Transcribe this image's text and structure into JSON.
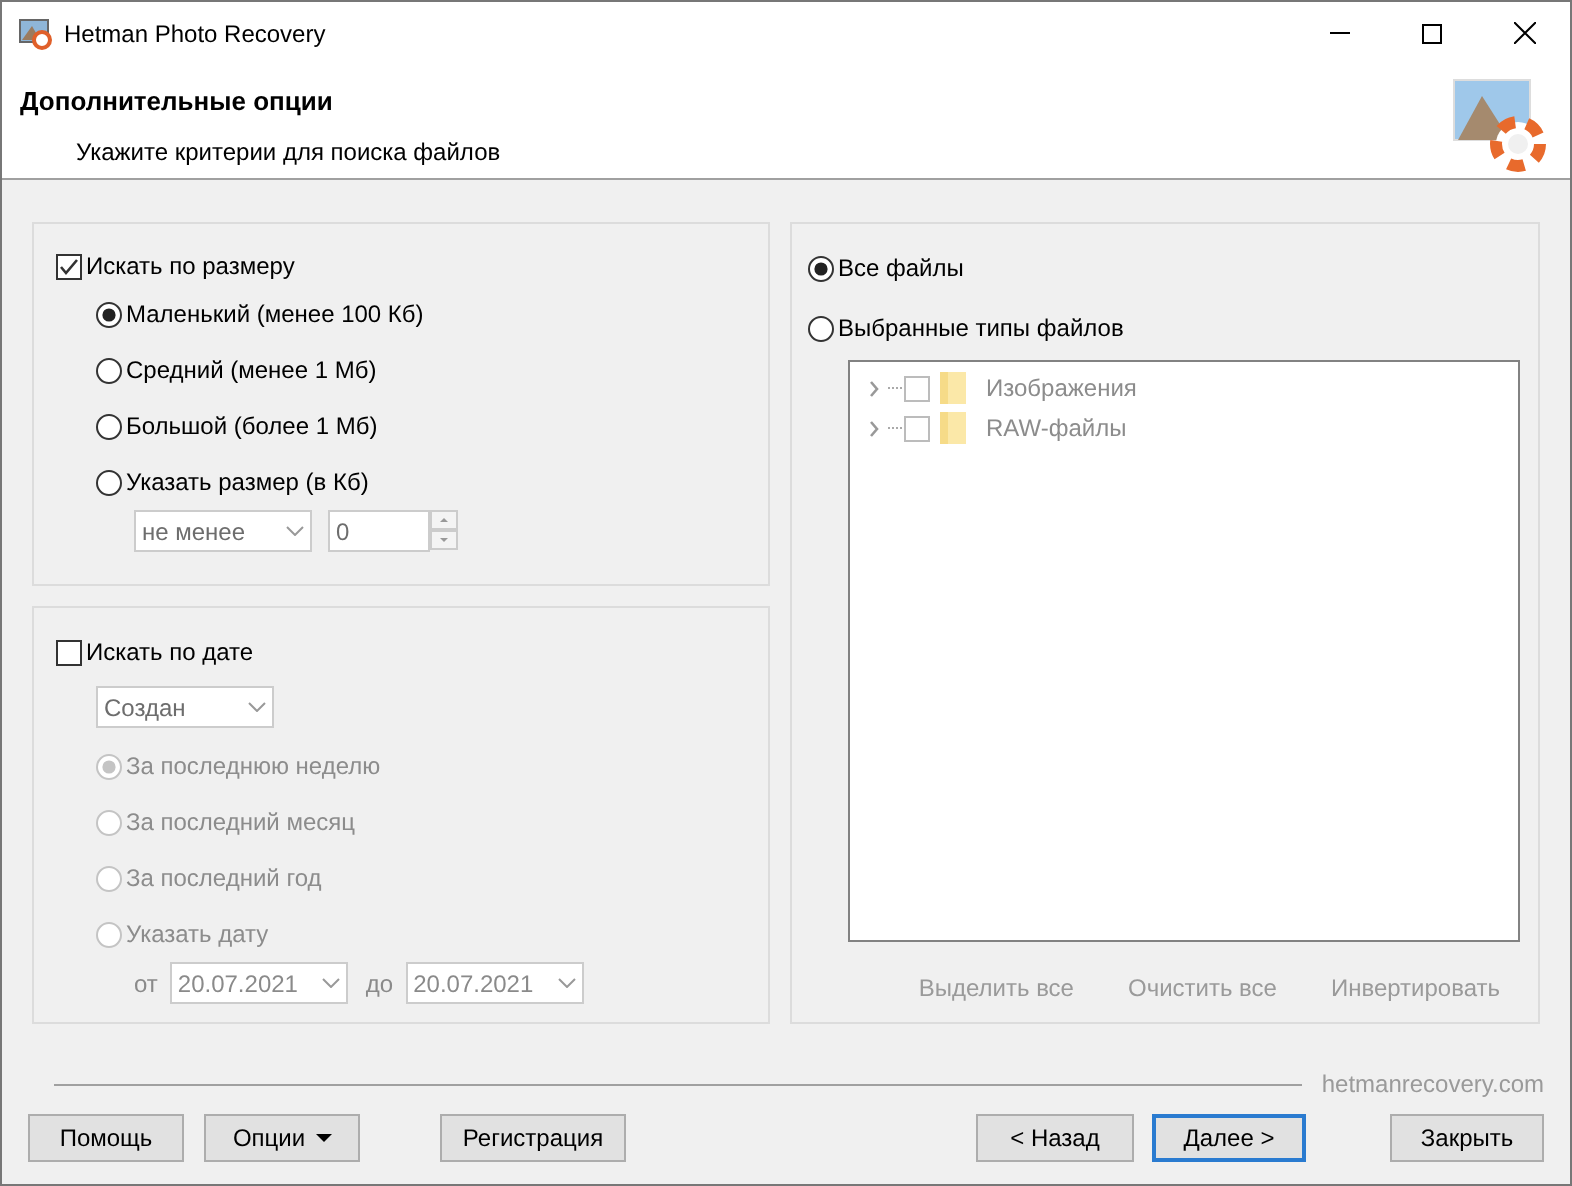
{
  "window": {
    "title": "Hetman Photo Recovery"
  },
  "header": {
    "title": "Дополнительные опции",
    "subtitle": "Укажите критерии для поиска файлов"
  },
  "size_filter": {
    "label": "Искать по размеру",
    "checked": true,
    "options": [
      {
        "label": "Маленький (менее 100 Кб)",
        "selected": true
      },
      {
        "label": "Средний (менее 1 Мб)",
        "selected": false
      },
      {
        "label": "Большой (более 1 Мб)",
        "selected": false
      },
      {
        "label": "Указать размер (в Кб)",
        "selected": false
      }
    ],
    "comparison": {
      "value": "не менее",
      "disabled": true
    },
    "size": {
      "value": "0",
      "disabled": true
    }
  },
  "date_filter": {
    "label": "Искать по дате",
    "checked": false,
    "date_type": {
      "value": "Создан"
    },
    "options": [
      {
        "label": "За последнюю неделю",
        "selected": true,
        "disabled": true
      },
      {
        "label": "За последний месяц",
        "selected": false,
        "disabled": true
      },
      {
        "label": "За последний год",
        "selected": false,
        "disabled": true
      },
      {
        "label": "Указать дату",
        "selected": false,
        "disabled": true
      }
    ],
    "from_label": "от",
    "from": "20.07.2021",
    "to_label": "до",
    "to": "20.07.2021"
  },
  "file_types": {
    "options": [
      {
        "label": "Все файлы",
        "selected": true
      },
      {
        "label": "Выбранные типы файлов",
        "selected": false
      }
    ],
    "tree": [
      {
        "label": "Изображения",
        "checked": false,
        "expanded": false,
        "disabled": true
      },
      {
        "label": "RAW-файлы",
        "checked": false,
        "expanded": false,
        "disabled": true
      }
    ],
    "actions": [
      {
        "label": "Выделить все",
        "disabled": true
      },
      {
        "label": "Очистить все",
        "disabled": true
      },
      {
        "label": "Инвертировать",
        "disabled": true
      }
    ]
  },
  "footer": {
    "website": "hetmanrecovery.com",
    "buttons": [
      {
        "label": "Помощь",
        "kind": "plain"
      },
      {
        "label": "Опции",
        "kind": "menu"
      },
      {
        "label": "Регистрация",
        "kind": "plain"
      },
      {
        "label": "< Назад",
        "kind": "plain"
      },
      {
        "label": "Далее >",
        "kind": "default"
      },
      {
        "label": "Закрыть",
        "kind": "plain"
      }
    ]
  }
}
